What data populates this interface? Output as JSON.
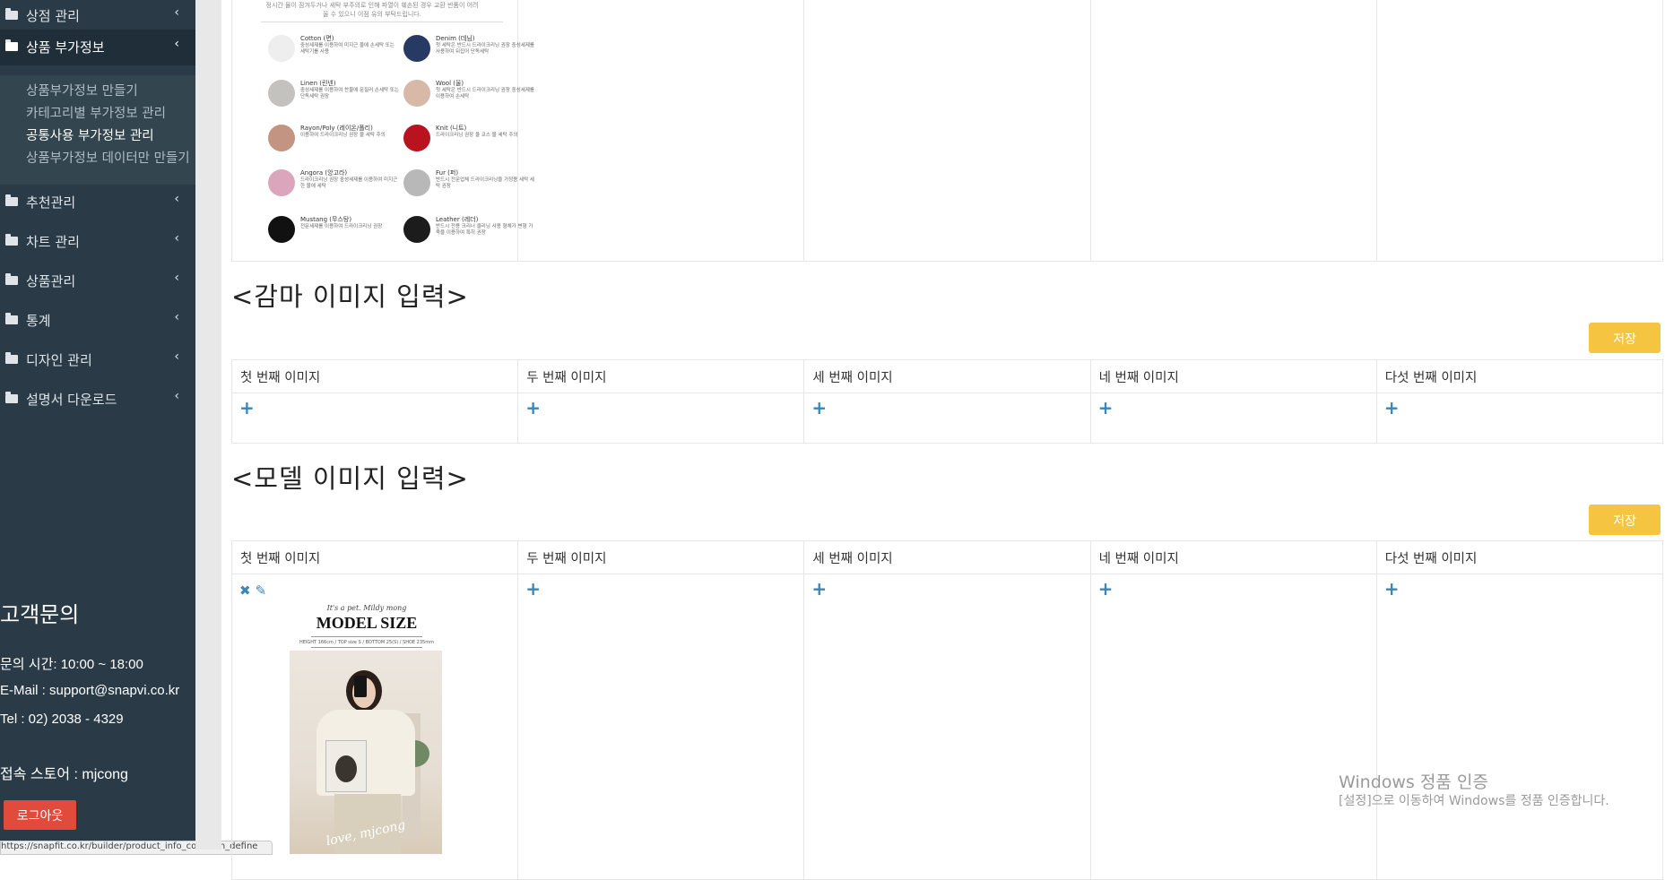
{
  "sidebar": {
    "menu": [
      {
        "label": "상점 관리"
      },
      {
        "label": "상품 부가정보"
      },
      {
        "label": "추천관리"
      },
      {
        "label": "차트 관리"
      },
      {
        "label": "상품관리"
      },
      {
        "label": "통계"
      },
      {
        "label": "디자인 관리"
      },
      {
        "label": "설명서 다운로드"
      }
    ],
    "submenu": [
      {
        "label": "상품부가정보 만들기"
      },
      {
        "label": "카테고리별 부가정보 관리"
      },
      {
        "label": "공통사용 부가정보 관리"
      },
      {
        "label": "상품부가정보 데이터만 만들기"
      }
    ],
    "contact": {
      "title": "고객문의",
      "hours": "문의 시간: 10:00 ~ 18:00",
      "email": "E-Mail : support@snapvi.co.kr",
      "tel": "Tel : 02) 2038 - 4329",
      "store": "접속 스토어 : mjcong"
    },
    "logout_label": "로그아웃"
  },
  "status_url": "https://snapfit.co.kr/builder/product_info_common_define",
  "sections": {
    "gamma": {
      "title": "<감마 이미지 입력>",
      "save_label": "저장"
    },
    "model": {
      "title": "<모델 이미지 입력>",
      "save_label": "저장"
    }
  },
  "columns": [
    "첫 번째 이미지",
    "두 번째 이미지",
    "세 번째 이미지",
    "네 번째 이미지",
    "다섯 번째 이미지"
  ],
  "fabric_guide": {
    "note": "정시간 물이 잠겨두거나 세탁 부주의로 인해 파열이 훼손된 경우 교환 반품이 어려울 수 있으니 이점 유의 부탁드립니다.",
    "items": [
      {
        "name": "Cotton (면)",
        "desc": "중성세제를 이용하여 미지근 물에 손세탁 또는 세탁기를 사용",
        "color": "#eeeeee"
      },
      {
        "name": "Denim (데님)",
        "desc": "첫 세탁은 반드시 드라이크리닝 권장 중성세제를 사용하여 뒤집어 단독세탁",
        "color": "#263a64"
      },
      {
        "name": "Linen (린넨)",
        "desc": "중성세제를 이용하여 찬물에 문질러 손세탁 또는 단독세탁 권장",
        "color": "#c4c2bf"
      },
      {
        "name": "Wool (울)",
        "desc": "첫 세탁은 반드시 드라이크리닝 권장 중성세제를 이용하여 손세탁",
        "color": "#d8b8a6"
      },
      {
        "name": "Rayon/Poly (레이온/폴리)",
        "desc": "이용하여 드라이크리닝 권장 물 세탁 주의",
        "color": "#c49482"
      },
      {
        "name": "Knit (니트)",
        "desc": "드라이크리닝 권장 울 코스 물 세탁 주의",
        "color": "#b8131e"
      },
      {
        "name": "Angora (앙고라)",
        "desc": "드라이크리닝 권장 중성세제를 이용하여 미지근한 물에 세탁",
        "color": "#dba6bc"
      },
      {
        "name": "Fur (퍼)",
        "desc": "반드시 전문업체 드라이크리닝을 가정용 세탁 세탁 권장",
        "color": "#b8b8b8"
      },
      {
        "name": "Mustang (무스탕)",
        "desc": "전문세제를 이용하여 드라이크리닝 권장",
        "color": "#111111"
      },
      {
        "name": "Leather (레더)",
        "desc": "반드시 전용 크리너 클리닝 사용 형체가 변형 가죽을 이용하여 특히 권장",
        "color": "#1c1c1c"
      }
    ]
  },
  "model_size": {
    "subtitle": "It's a pet. Mildy mong",
    "title": "MODEL SIZE",
    "specs": "HEIGHT 166cm / TOP size S / BOTTOM 25(S) / SHOE 235mm",
    "footer": "love, mjcong"
  },
  "watermark": {
    "line1": "Windows 정품 인증",
    "line2": "[설정]으로 이동하여 Windows를 정품 인증합니다."
  },
  "colors": {
    "sidebar_bg": "#2a3b47",
    "save_button": "#f5c542",
    "logout_button": "#e04b3b",
    "plus_icon": "#3a86b8"
  }
}
